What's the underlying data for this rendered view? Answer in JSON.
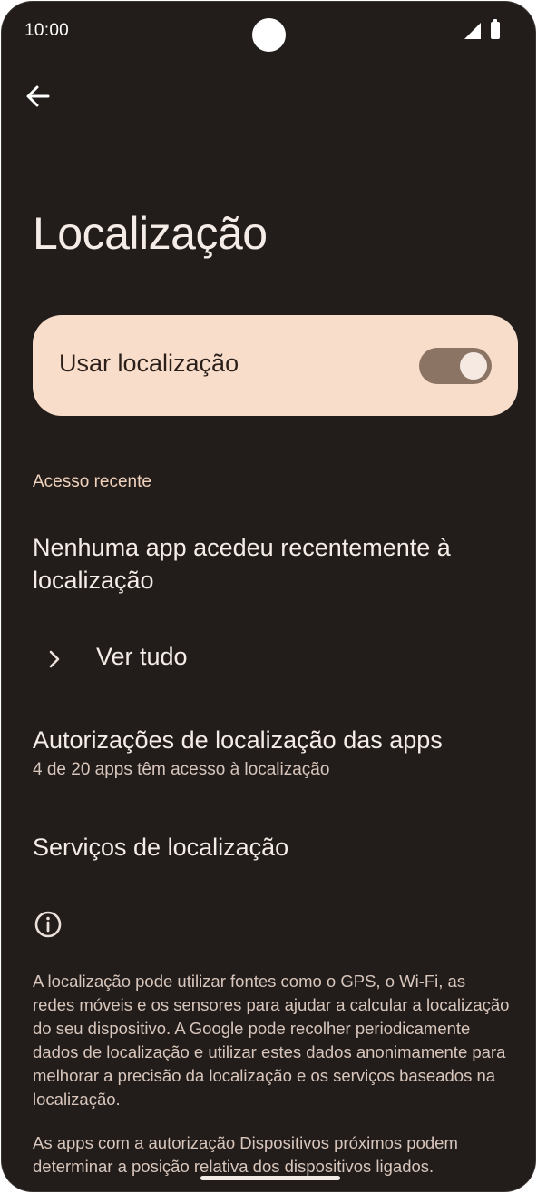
{
  "status_bar": {
    "time": "10:00"
  },
  "page": {
    "title": "Localização"
  },
  "main_toggle": {
    "label": "Usar localização",
    "on": true
  },
  "recent_access": {
    "header": "Acesso recente",
    "empty_message": "Nenhuma app acedeu recentemente à localização",
    "see_all_label": "Ver tudo"
  },
  "app_permissions": {
    "title": "Autorizações de localização das apps",
    "summary": "4 de 20 apps têm acesso à localização"
  },
  "location_services": {
    "title": "Serviços de localização"
  },
  "footer_info": {
    "paragraph_1": "A localização pode utilizar fontes como o GPS, o Wi-Fi, as redes móveis e os sensores para ajudar a calcular a localização do seu dispositivo. A Google pode recolher periodicamente dados de localização e utilizar estes dados anonimamente para melhorar a precisão da localização e os serviços baseados na localização.",
    "paragraph_2": "As apps com a autorização Dispositivos próximos podem determinar a posição relativa dos dispositivos ligados."
  },
  "colors": {
    "background": "#221d1a",
    "card": "#f9ddcb",
    "switch_track": "#8b7464",
    "section_header": "#f0d2bd"
  },
  "icons": {
    "back": "arrow-back-icon",
    "chevron": "chevron-right-icon",
    "info": "info-icon"
  }
}
